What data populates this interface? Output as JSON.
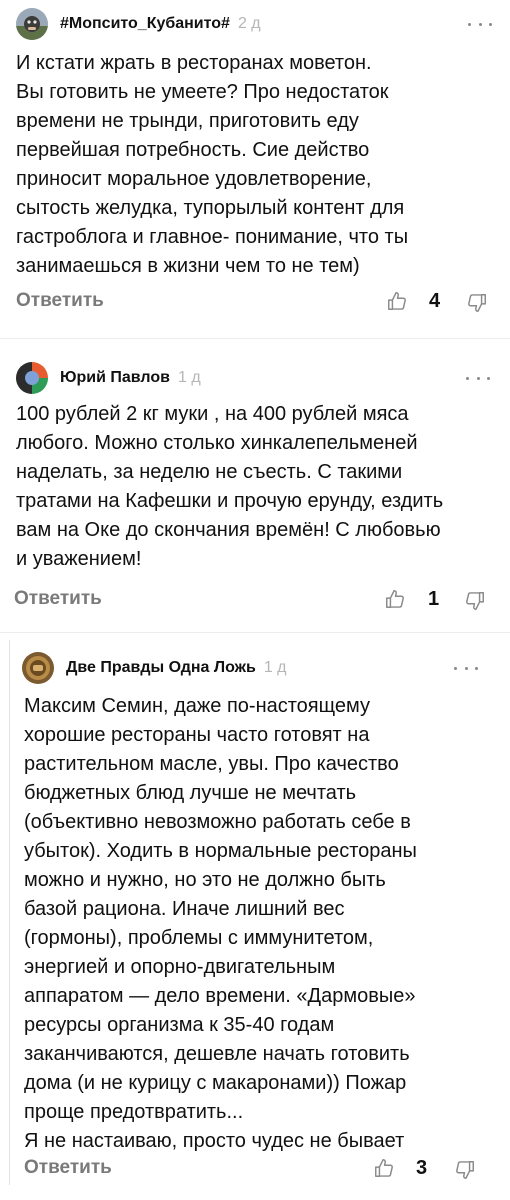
{
  "comments": [
    {
      "author": "#Мопсито_Кубанито#",
      "date": "2 д",
      "text": "И кстати жрать в ресторанах моветон.\nВы готовить не умеете? Про недостаток\nвремени не трынди, приготовить еду\nпервейшая потребность. Сие действо\nприносит моральное удовлетворение,\nсытость желудка, тупорылый контент для\nгастроблога и главное- понимание, что ты\nзанимаешься в жизни чем то не тем)",
      "reply_label": "Ответить",
      "likes": "4"
    },
    {
      "author": "Юрий Павлов",
      "date": "1 д",
      "text": "100 рублей 2 кг муки , на 400 рублей мяса\nлюбого. Можно столько хинкалепельменей\nнаделать, за неделю не съесть. С такими\nтратами на Кафешки и прочую ерунду, ездить\nвам на Оке до скончания времён! С любовью\nи уважением!",
      "reply_label": "Ответить",
      "likes": "1"
    },
    {
      "author": "Две Правды Одна Ложь",
      "date": "1 д",
      "text": "Максим Семин, даже по-настоящему\nхорошие рестораны часто готовят на\nрастительном масле, увы. Про качество\nбюджетных блюд лучше не мечтать\n(объективно невозможно работать себе в\nубыток). Ходить в нормальные рестораны\nможно и нужно, но это не должно быть\nбазой рациона. Иначе лишний вес\n(гормоны), проблемы с иммунитетом,\nэнергией и опорно-двигательным\nаппаратом — дело времени. «Дармовые»\nресурсы организма к 35-40 годам\nзаканчиваются, дешевле начать готовить\nдома (и не курицу с макаронами)) Пожар\nпроще предотвратить...\nЯ не настаиваю, просто чудес не бывает",
      "reply_label": "Ответить",
      "likes": "3"
    }
  ],
  "colors": {
    "meta_gray": "#b6b6b6",
    "reply_gray": "#7a7a7a",
    "icon_gray": "#8a8a8a"
  },
  "icons": {
    "like": "thumbs-up-icon",
    "dislike": "thumbs-down-icon",
    "more": "more-dots-icon"
  }
}
